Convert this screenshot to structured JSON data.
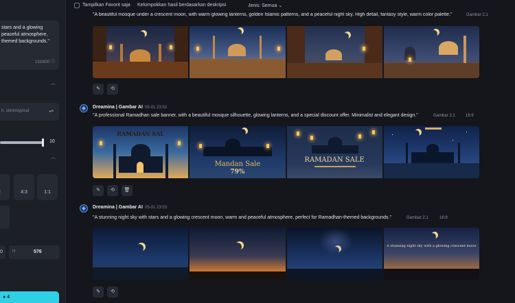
{
  "sidebar": {
    "prompt_text": "stars and a glowing peaceful atmosphere, themed backgrounds.\"",
    "char_count": "133/800",
    "negative_placeholder": "h, stereotypical",
    "slider_value": "10",
    "ratios": [
      "2",
      "4:3",
      "1:1"
    ],
    "ratio_partial": "6",
    "dim_label": "0",
    "dim_h_label": "H",
    "dim_h_value": "576",
    "generate_cost": "4"
  },
  "toolbar": {
    "favorites_label": "Tampilkan Favorit saja",
    "group_label": "Kelompokkan hasil berdasarkan deskripsi",
    "type_label": "Jenis: Semua"
  },
  "generations": [
    {
      "prompt": "\"A beautiful mosque under a crescent moon, with warm glowing lanterns, golden Islamic patterns, and a peaceful night sky. High detail, fantasy style, warm color palette.\"",
      "model": "Gambar 2.1"
    },
    {
      "author": "Dreamina | Gambar AI",
      "time": "05-01  23:52",
      "prompt": "\"A professional Ramadhan sale banner, with a beautiful mosque silhouette, glowing lanterns, and a special discount offer. Minimalist and elegant design.\"",
      "model": "Gambar 2.1",
      "ratio": "16:9",
      "banner_texts": [
        "RAMADAN SAL",
        "Mandan Sale",
        "79%",
        "RAMADAN SALE"
      ]
    },
    {
      "author": "Dreamina | Gambar AI",
      "time": "05-01  23:53",
      "prompt": "\"A stunning night sky with stars and a glowing crescent moon, warm and peaceful atmosphere, perfect for Ramadhan-themed backgrounds.\"",
      "model": "Gambar 2.1",
      "ratio": "16:9",
      "overlay_text": "A stunning night sky with a glowing crescent moon"
    }
  ],
  "colors": {
    "accent": "#2fd0e6",
    "background": "#14161b",
    "panel": "#1c1f26"
  }
}
